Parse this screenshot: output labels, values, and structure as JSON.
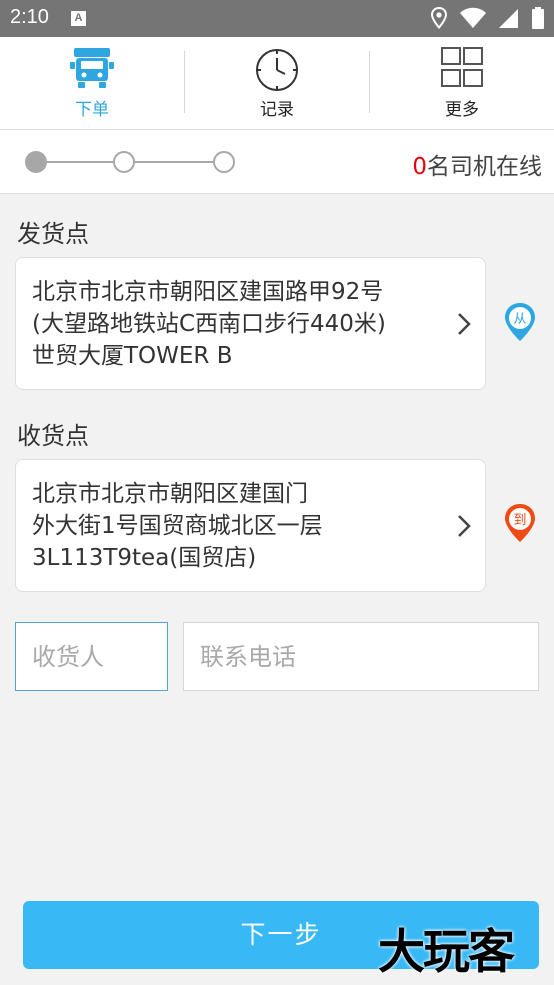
{
  "status_bar": {
    "time": "2:10",
    "notification_icon_letter": "A",
    "icons": [
      "location-icon",
      "wifi-icon",
      "signal-icon",
      "battery-icon"
    ]
  },
  "tabs": [
    {
      "label": "下单",
      "icon": "truck-icon",
      "active": true
    },
    {
      "label": "记录",
      "icon": "clock-icon",
      "active": false
    },
    {
      "label": "更多",
      "icon": "grid-icon",
      "active": false
    }
  ],
  "progress": {
    "total_steps": 3,
    "current_step": 1,
    "online_count": "0",
    "online_suffix": "名司机在线"
  },
  "pickup": {
    "label": "发货点",
    "address_lines": [
      "北京市北京市朝阳区建国路甲92号",
      "(大望路地铁站C西南口步行440米)",
      "世贸大厦TOWER B"
    ],
    "pin_char": "从"
  },
  "delivery": {
    "label": "收货点",
    "address_lines": [
      "北京市北京市朝阳区建国门",
      "外大街1号国贸商城北区一层",
      "3L113T9tea(国贸店)"
    ],
    "pin_char": "到"
  },
  "receiver": {
    "name_placeholder": "收货人",
    "phone_placeholder": "联系电话"
  },
  "next_button_label": "下一步",
  "watermark_text": "大玩客",
  "colors": {
    "accent": "#2ea7e0",
    "button": "#38b9f5",
    "count": "#e8000b",
    "pickup_pin": "#2ea7e0",
    "delivery_pin": "#ef4a14",
    "status_bar": "#757575"
  }
}
